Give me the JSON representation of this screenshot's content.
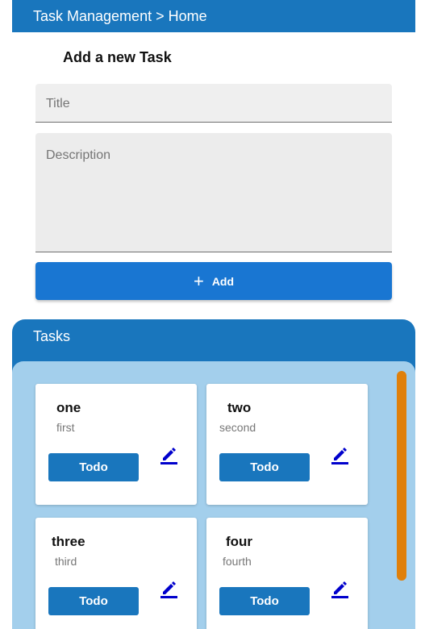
{
  "header": {
    "breadcrumb": "Task Management > Home"
  },
  "form": {
    "title": "Add a new Task",
    "title_placeholder": "Title",
    "description_placeholder": "Description",
    "add_label": "Add"
  },
  "tasks": {
    "heading": "Tasks",
    "items": [
      {
        "name": "one",
        "description": "first",
        "status": "Todo"
      },
      {
        "name": "two",
        "description": "second",
        "status": "Todo"
      },
      {
        "name": "three",
        "description": "third",
        "status": "Todo"
      },
      {
        "name": "four",
        "description": "fourth",
        "status": "Todo"
      }
    ]
  },
  "colors": {
    "primary": "#1976bd",
    "button": "#1976d2",
    "list_background": "#a3cfec",
    "scrollbar": "#e0800a",
    "edit_icon": "#0000cc"
  },
  "icons": {
    "add": "plus-icon",
    "edit": "pencil-icon"
  }
}
